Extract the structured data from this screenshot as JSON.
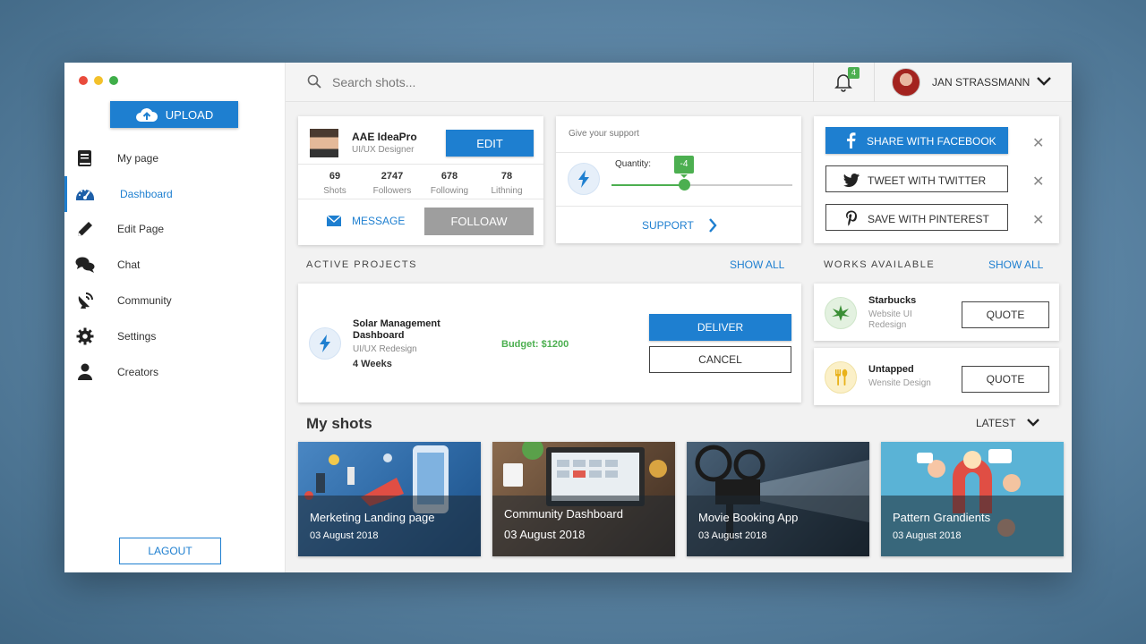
{
  "colors": {
    "accent": "#1e7fd0",
    "success": "#4caf50",
    "follow": "#9e9e9e"
  },
  "sidebar": {
    "upload_label": "UPLOAD",
    "items": [
      {
        "label": "My page",
        "icon": "book-icon"
      },
      {
        "label": "Dashboard",
        "icon": "dashboard-icon",
        "active": true
      },
      {
        "label": "Edit Page",
        "icon": "pencil-icon"
      },
      {
        "label": "Chat",
        "icon": "chat-icon"
      },
      {
        "label": "Community",
        "icon": "satellite-icon"
      },
      {
        "label": "Settings",
        "icon": "gear-icon"
      },
      {
        "label": "Creators",
        "icon": "user-icon"
      }
    ],
    "logout_label": "LAGOUT"
  },
  "topbar": {
    "search_placeholder": "Search shots...",
    "notification_count": "4",
    "user_name": "JAN STRASSMANN"
  },
  "profile": {
    "name": "AAE IdeaPro",
    "role": "UI/UX Designer",
    "edit_label": "EDIT",
    "stats": [
      {
        "value": "69",
        "label": "Shots"
      },
      {
        "value": "2747",
        "label": "Followers"
      },
      {
        "value": "678",
        "label": "Following"
      },
      {
        "value": "78",
        "label": "Lithning"
      }
    ],
    "message_label": "MESSAGE",
    "follow_label": "FOLLOAW"
  },
  "support": {
    "title": "Give your support",
    "quantity_label": "Quantity:",
    "quantity_value": "-4",
    "slider_fraction": 0.4,
    "support_label": "SUPPORT"
  },
  "share": {
    "facebook_label": "SHARE WITH FACEBOOK",
    "twitter_label": "TWEET WITH TWITTER",
    "pinterest_label": "SAVE WITH PINTEREST",
    "close_symbol": "✕"
  },
  "active_projects": {
    "heading": "ACTIVE PROJECTS",
    "show_all": "SHOW ALL",
    "project": {
      "title": "Solar Management Dashboard",
      "subtitle": "UI/UX Redesign",
      "duration": "4 Weeks",
      "budget": "Budget: $1200",
      "deliver_label": "DELIVER",
      "cancel_label": "CANCEL"
    }
  },
  "works": {
    "heading": "WORKS AVAILABLE",
    "show_all": "SHOW ALL",
    "items": [
      {
        "name": "Starbucks",
        "desc": "Website UI Redesign",
        "quote_label": "QUOTE",
        "icon": "leaf-icon"
      },
      {
        "name": "Untapped",
        "desc": "Wensite Design",
        "quote_label": "QUOTE",
        "icon": "fork-spoon-icon"
      }
    ]
  },
  "shots": {
    "heading": "My shots",
    "sort_label": "LATEST",
    "items": [
      {
        "title": "Merketing Landing page",
        "date": "03 August 2018"
      },
      {
        "title": "Community Dashboard",
        "date": "03 August 2018"
      },
      {
        "title": "Movie Booking App",
        "date": "03 August 2018"
      },
      {
        "title": "Pattern Grandients",
        "date": "03 August 2018"
      }
    ]
  }
}
